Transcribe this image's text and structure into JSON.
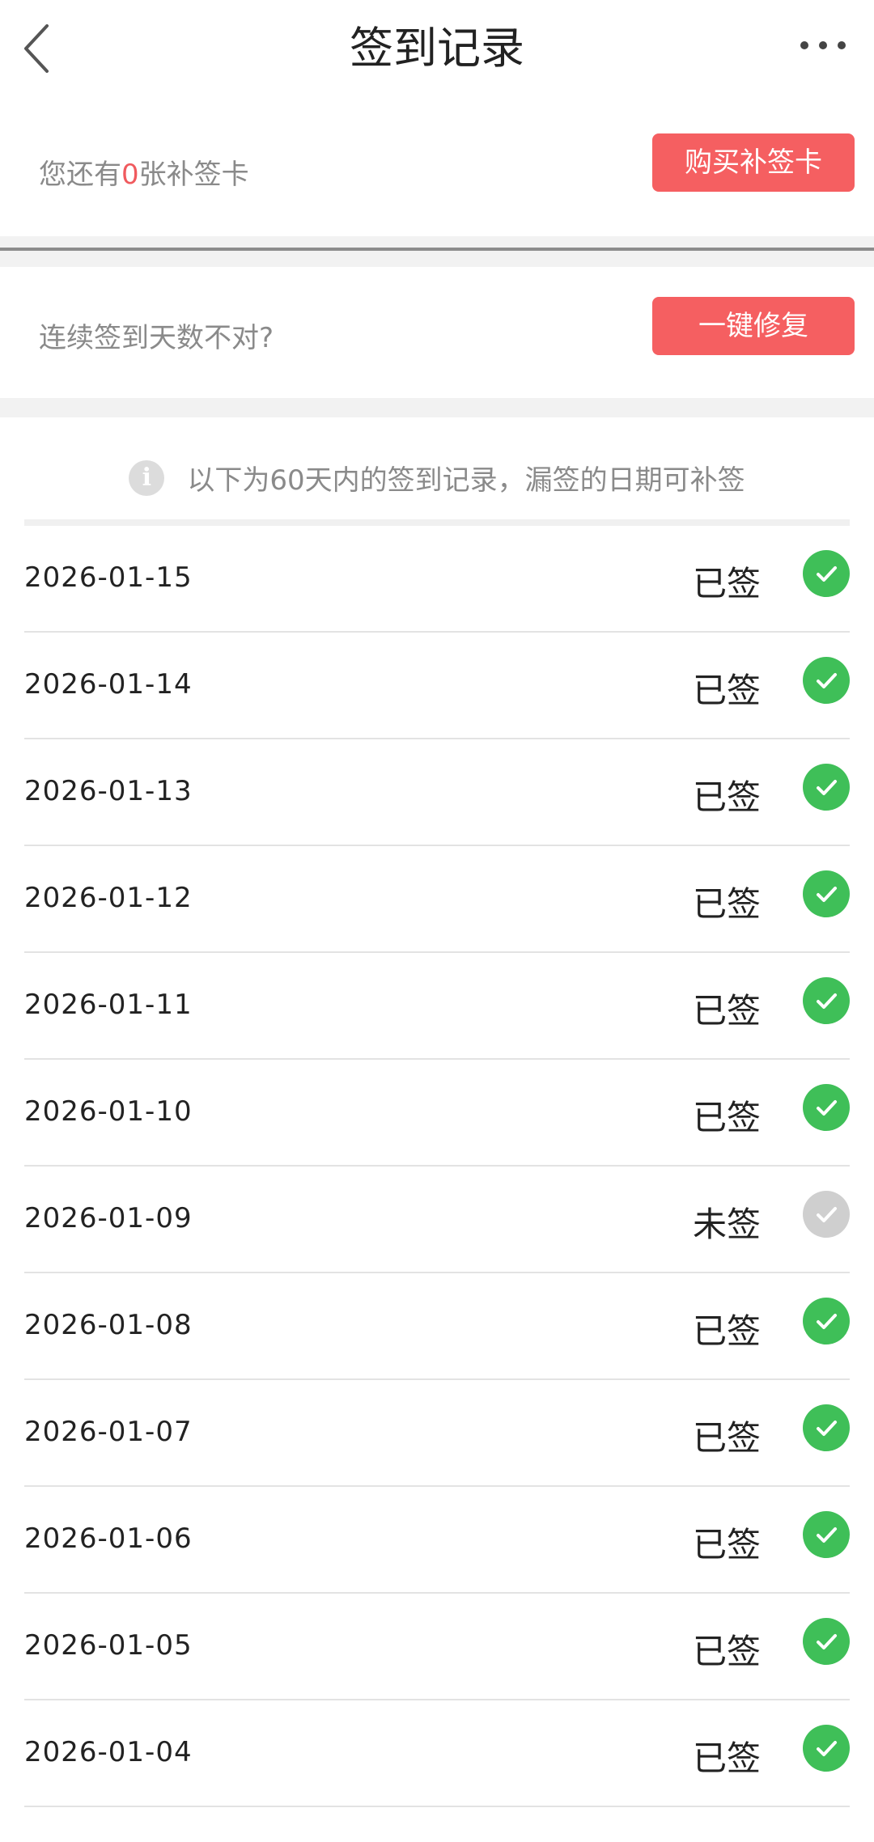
{
  "header": {
    "title": "签到记录"
  },
  "makeup_card": {
    "prefix": "您还有",
    "count": "0",
    "suffix": "张补签卡",
    "button": "购买补签卡"
  },
  "repair": {
    "text": "连续签到天数不对?",
    "button": "一键修复"
  },
  "notice": {
    "text": "以下为60天内的签到记录，漏签的日期可补签"
  },
  "colors": {
    "accent": "#f55f61",
    "signed": "#3fbf58",
    "unsigned": "#cfcfcf"
  },
  "records": [
    {
      "date": "2026-01-15",
      "status": "已签",
      "signed": true
    },
    {
      "date": "2026-01-14",
      "status": "已签",
      "signed": true
    },
    {
      "date": "2026-01-13",
      "status": "已签",
      "signed": true
    },
    {
      "date": "2026-01-12",
      "status": "已签",
      "signed": true
    },
    {
      "date": "2026-01-11",
      "status": "已签",
      "signed": true
    },
    {
      "date": "2026-01-10",
      "status": "已签",
      "signed": true
    },
    {
      "date": "2026-01-09",
      "status": "未签",
      "signed": false
    },
    {
      "date": "2026-01-08",
      "status": "已签",
      "signed": true
    },
    {
      "date": "2026-01-07",
      "status": "已签",
      "signed": true
    },
    {
      "date": "2026-01-06",
      "status": "已签",
      "signed": true
    },
    {
      "date": "2026-01-05",
      "status": "已签",
      "signed": true
    },
    {
      "date": "2026-01-04",
      "status": "已签",
      "signed": true
    }
  ]
}
